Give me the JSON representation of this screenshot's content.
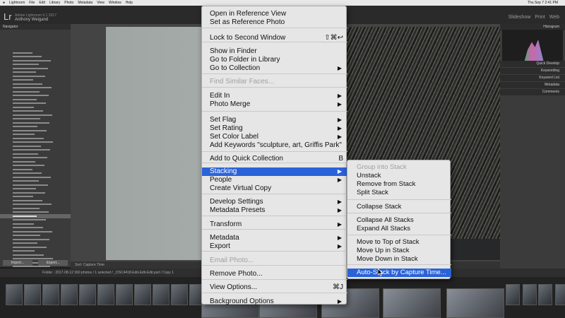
{
  "macbar": {
    "apple": "",
    "items": [
      "Lightroom",
      "File",
      "Edit",
      "Library",
      "Photo",
      "Metadata",
      "View",
      "Window",
      "Help"
    ],
    "clock": "Thu Sep 7 2:41 PM"
  },
  "identity": {
    "logo": "Lr",
    "subtitle": "Adobe Lightroom 6.1 2017",
    "name": "Anthony Weigand"
  },
  "modules": [
    "Slideshow",
    "Print",
    "Web"
  ],
  "left_panel": {
    "navigator_label": "Navigator",
    "import_label": "Import...",
    "export_label": "Export..."
  },
  "right_panel": {
    "histogram_label": "Histogram",
    "sections": [
      "Quick Develop",
      "Keywording",
      "Keyword List",
      "Metadata",
      "Comments"
    ]
  },
  "toolbar_text": "Sort: Capture Time",
  "filmstrip_path": "Folder : 2017-08-12   360 photos / 1 selected / _DSC4418-Edit-Edit-Edit.psd / Copy 1",
  "menu": {
    "items": [
      {
        "label": "Open in Reference View",
        "disabled": false
      },
      {
        "label": "Set as Reference Photo",
        "disabled": false
      },
      {
        "label": "Lock to Second Window",
        "shortcut": "⇧⌘↩",
        "disabled": false
      },
      {
        "label": "Show in Finder",
        "disabled": false
      },
      {
        "label": "Go to Folder in Library",
        "disabled": false
      },
      {
        "label": "Go to Collection",
        "submenu": true,
        "disabled": false
      },
      {
        "label": "Find Similar Faces...",
        "disabled": true
      },
      {
        "label": "Edit In",
        "submenu": true,
        "disabled": false
      },
      {
        "label": "Photo Merge",
        "submenu": true,
        "disabled": false
      },
      {
        "label": "Set Flag",
        "submenu": true,
        "disabled": false
      },
      {
        "label": "Set Rating",
        "submenu": true,
        "disabled": false
      },
      {
        "label": "Set Color Label",
        "submenu": true,
        "disabled": false
      },
      {
        "label": "Add Keywords \"sculpture, art, Griffis Park\"",
        "disabled": false
      },
      {
        "label": "Add to Quick Collection",
        "shortcut": "B",
        "disabled": false
      },
      {
        "label": "Stacking",
        "submenu": true,
        "highlighted": true,
        "disabled": false
      },
      {
        "label": "People",
        "submenu": true,
        "disabled": false
      },
      {
        "label": "Create Virtual Copy",
        "disabled": false
      },
      {
        "label": "Develop Settings",
        "submenu": true,
        "disabled": false
      },
      {
        "label": "Metadata Presets",
        "submenu": true,
        "disabled": false
      },
      {
        "label": "Transform",
        "submenu": true,
        "disabled": false
      },
      {
        "label": "Metadata",
        "submenu": true,
        "disabled": false
      },
      {
        "label": "Export",
        "submenu": true,
        "disabled": false
      },
      {
        "label": "Email Photo...",
        "disabled": true
      },
      {
        "label": "Remove Photo...",
        "disabled": false
      },
      {
        "label": "View Options...",
        "shortcut": "⌘J",
        "disabled": false
      },
      {
        "label": "Background Options",
        "submenu": true,
        "disabled": false
      }
    ]
  },
  "submenu": {
    "items": [
      {
        "label": "Group into Stack",
        "disabled": true
      },
      {
        "label": "Unstack",
        "disabled": false
      },
      {
        "label": "Remove from Stack",
        "disabled": false
      },
      {
        "label": "Split Stack",
        "disabled": false
      },
      {
        "label": "Collapse Stack",
        "disabled": false
      },
      {
        "label": "Collapse All Stacks",
        "disabled": false
      },
      {
        "label": "Expand All Stacks",
        "disabled": false
      },
      {
        "label": "Move to Top of Stack",
        "disabled": false
      },
      {
        "label": "Move Up in Stack",
        "disabled": false
      },
      {
        "label": "Move Down in Stack",
        "disabled": false
      },
      {
        "label": "Auto-Stack by Capture Time...",
        "highlighted": true,
        "disabled": false
      }
    ]
  }
}
